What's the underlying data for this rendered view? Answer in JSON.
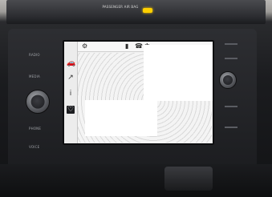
{
  "dashboard": {
    "airbag_text": "PASSENGER\nAIR BAG"
  },
  "unit": {
    "left_labels": [
      "RADIO",
      "MEDIA",
      "PHONE",
      "VOICE"
    ]
  },
  "screen": {
    "sidebar_icons": [
      "car-icon",
      "route-icon",
      "info-icon",
      "heart-icon"
    ],
    "status_icons": [
      "settings-icon",
      "signal-icon",
      "phone-icon",
      "bluetooth-icon"
    ]
  }
}
